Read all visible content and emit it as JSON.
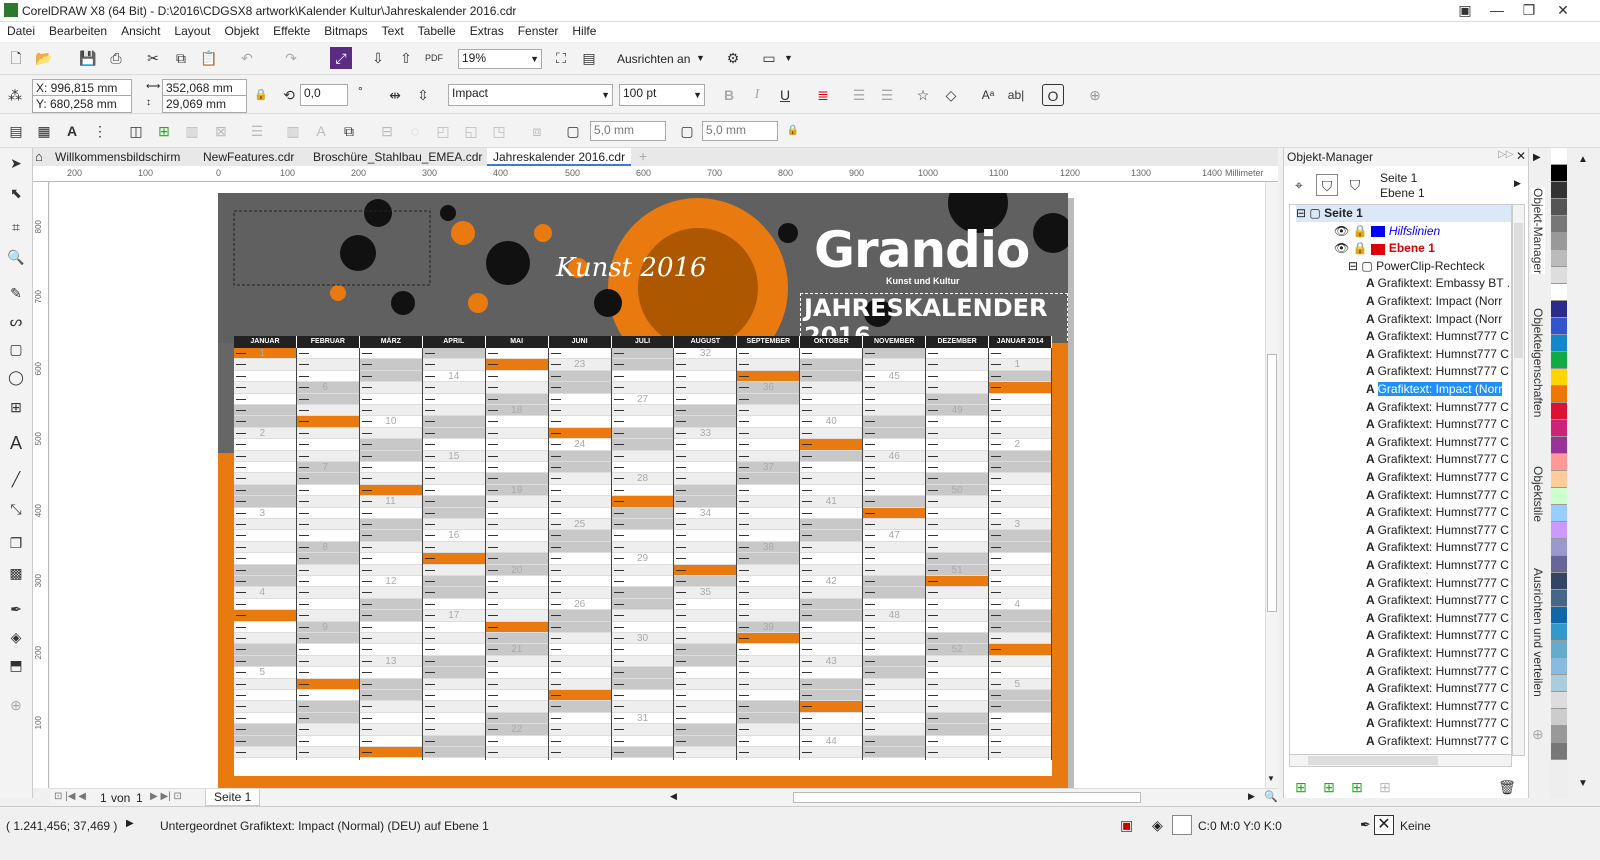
{
  "titlebar": {
    "title": "CorelDRAW X8 (64 Bit) - D:\\2016\\CDGSX8 artwork\\Kalender Kultur\\Jahreskalender 2016.cdr",
    "minimize": "—",
    "restore": "❐",
    "close": "✕"
  },
  "menu": [
    "Datei",
    "Bearbeiten",
    "Ansicht",
    "Layout",
    "Objekt",
    "Effekte",
    "Bitmaps",
    "Text",
    "Tabelle",
    "Extras",
    "Fenster",
    "Hilfe"
  ],
  "toolbar1": {
    "zoom": "19%",
    "snap_label": "Ausrichten an"
  },
  "propbar": {
    "x": "X: 996,815 mm",
    "y": "Y: 680,258 mm",
    "w": "352,068 mm",
    "h": "29,069 mm",
    "angle": "0,0",
    "font": "Impact",
    "size": "100 pt"
  },
  "toolbar3": {
    "nudge1": "5,0 mm",
    "nudge2": "5,0 mm"
  },
  "tabs": [
    "Willkommensbildschirm",
    "NewFeatures.cdr",
    "Broschüre_Stahlbau_EMEA.cdr",
    "Jahreskalender 2016.cdr"
  ],
  "ruler": {
    "unit": "Millimeter",
    "ticks": [
      "200",
      "100",
      "0",
      "100",
      "200",
      "300",
      "400",
      "500",
      "600",
      "700",
      "800",
      "900",
      "1000",
      "1100",
      "1200",
      "1300",
      "1400"
    ],
    "vticks": [
      "800",
      "700",
      "600",
      "500",
      "400",
      "300",
      "200",
      "100"
    ]
  },
  "document": {
    "title": "Grandio",
    "subtitle": "Kunst und Kultur",
    "headline": "JAHRESKALENDER 2016",
    "script": "Kunst 2016",
    "months": [
      "JANUAR",
      "FEBRUAR",
      "MÄRZ",
      "APRIL",
      "MAI",
      "JUNI",
      "JULI",
      "AUGUST",
      "SEPTEMBER",
      "OKTOBER",
      "NOVEMBER",
      "DEZEMBER",
      "JANUAR 2014"
    ],
    "weeks": [
      [
        "1",
        "2",
        "3",
        "4",
        "5"
      ],
      [
        "6",
        "7",
        "8",
        "9"
      ],
      [
        "10",
        "11",
        "12",
        "13"
      ],
      [
        "14",
        "15",
        "16",
        "17"
      ],
      [
        "18",
        "19",
        "20",
        "21",
        "22"
      ],
      [
        "23",
        "24",
        "25",
        "26"
      ],
      [
        "27",
        "28",
        "29",
        "30",
        "31"
      ],
      [
        "32",
        "33",
        "34",
        "35"
      ],
      [
        "36",
        "37",
        "38",
        "39"
      ],
      [
        "40",
        "41",
        "42",
        "43",
        "44"
      ],
      [
        "45",
        "46",
        "47",
        "48"
      ],
      [
        "49",
        "50",
        "51",
        "52"
      ],
      [
        "1",
        "2",
        "3",
        "4",
        "5"
      ]
    ]
  },
  "pager": {
    "current": "1",
    "of": "von",
    "total": "1",
    "page_tab": "Seite 1"
  },
  "objectmanager": {
    "title": "Objekt-Manager",
    "page": "Seite 1",
    "layer": "Ebene 1",
    "tree": [
      {
        "text": "Seite 1",
        "bold": true
      },
      {
        "text": "Hilfslinien",
        "color": "#0000ff",
        "italic": true
      },
      {
        "text": "Ebene 1",
        "color": "#d00",
        "bold": true
      },
      {
        "text": "PowerClip-Rechteck"
      },
      {
        "text": "Grafiktext: Embassy BT ..."
      },
      {
        "text": "Grafiktext: Impact (Norr"
      },
      {
        "text": "Grafiktext: Impact (Norr"
      },
      {
        "text": "Grafiktext: Humnst777 C"
      },
      {
        "text": "Grafiktext: Humnst777 C"
      },
      {
        "text": "Grafiktext: Humnst777 C"
      },
      {
        "text": "Grafiktext: Impact (Norr",
        "selected": true
      },
      {
        "text": "Grafiktext: Humnst777 C"
      },
      {
        "text": "Grafiktext: Humnst777 C"
      },
      {
        "text": "Grafiktext: Humnst777 C"
      },
      {
        "text": "Grafiktext: Humnst777 C"
      },
      {
        "text": "Grafiktext: Humnst777 C"
      },
      {
        "text": "Grafiktext: Humnst777 C"
      },
      {
        "text": "Grafiktext: Humnst777 C"
      },
      {
        "text": "Grafiktext: Humnst777 C"
      },
      {
        "text": "Grafiktext: Humnst777 C"
      },
      {
        "text": "Grafiktext: Humnst777 C"
      },
      {
        "text": "Grafiktext: Humnst777 C"
      },
      {
        "text": "Grafiktext: Humnst777 C"
      },
      {
        "text": "Grafiktext: Humnst777 C"
      },
      {
        "text": "Grafiktext: Humnst777 C"
      },
      {
        "text": "Grafiktext: Humnst777 C"
      },
      {
        "text": "Grafiktext: Humnst777 C"
      },
      {
        "text": "Grafiktext: Humnst777 C"
      },
      {
        "text": "Grafiktext: Humnst777 C"
      },
      {
        "text": "Grafiktext: Humnst777 C"
      },
      {
        "text": "Grafiktext: Humnst777 C"
      }
    ]
  },
  "sidetabs": [
    "Objekt-Manager",
    "Objekteigenschaften",
    "Objektstile",
    "Ausrichten und verteilen"
  ],
  "palette": [
    "#ffffff",
    "#000000",
    "#333333",
    "#555555",
    "#777777",
    "#999999",
    "#bbbbbb",
    "#dddddd",
    "#ffffff",
    "#2b2b8c",
    "#3355cc",
    "#1188cc",
    "#11aa44",
    "#ffd400",
    "#ee7700",
    "#dd1133",
    "#cc2277",
    "#993399",
    "#ff9999",
    "#ffcc99",
    "#ccffcc",
    "#99ccff",
    "#cc99ff",
    "#9999cc",
    "#666699",
    "#334466",
    "#446688",
    "#1166aa",
    "#3399cc",
    "#66aacc",
    "#88bbdd",
    "#aaccdd",
    "#dddddd",
    "#cccccc",
    "#999999",
    "#777777"
  ],
  "status": {
    "coords": "( 1.241,456; 37,469 )",
    "info": "Untergeordnet Grafiktext: Impact (Normal) (DEU) auf Ebene 1",
    "fill": "C:0 M:0 Y:0 K:0",
    "outline": "Keine"
  }
}
